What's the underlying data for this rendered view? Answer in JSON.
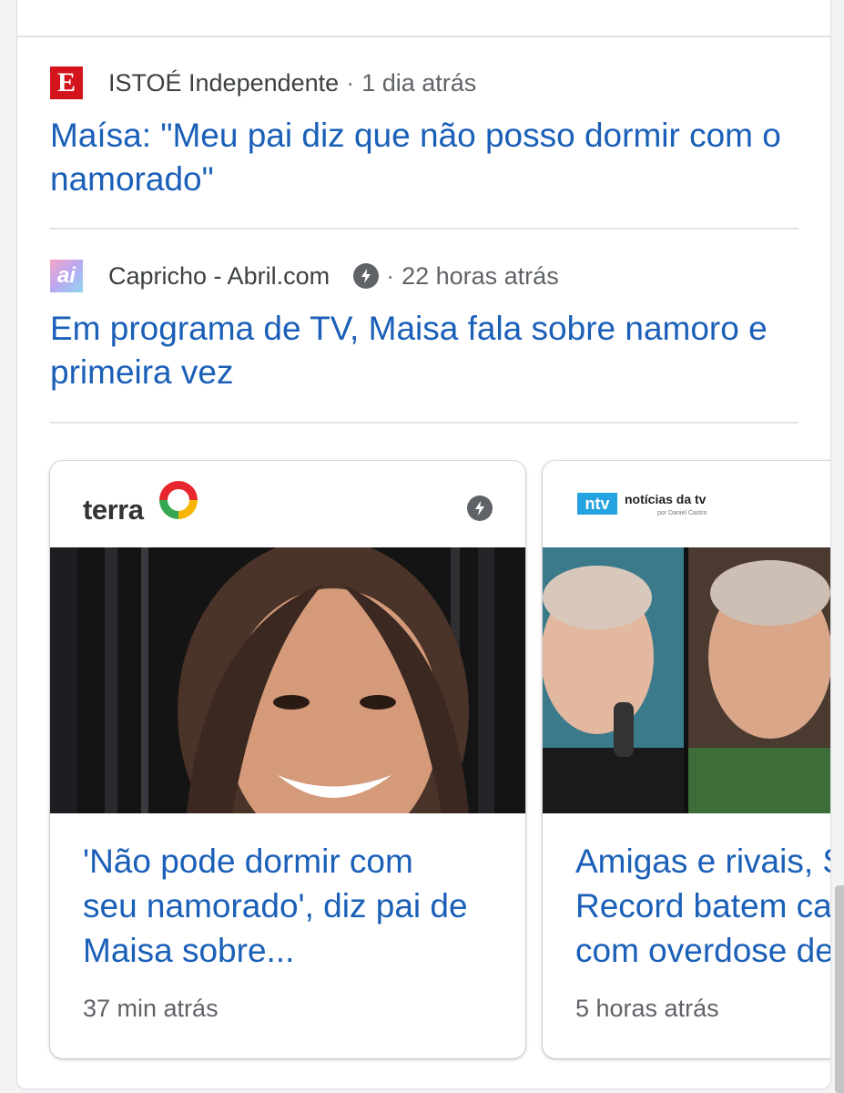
{
  "stories": [
    {
      "source": "ISTOÉ Independente",
      "time": "1 dia atrás",
      "headline": "Maísa: \"Meu pai diz que não posso dormir com o namorado\"",
      "logo_letter": "E",
      "logo_color": "#d3141c"
    },
    {
      "source": "Capricho - Abril.com",
      "time": "22 horas atrás",
      "headline": "Em programa de TV, Maisa fala sobre namoro e primeira vez",
      "logo_letter": "ai"
    }
  ],
  "separator": "·",
  "cards": [
    {
      "publisher": "terra",
      "title_lines": [
        "'Não pode dormir com",
        "seu namorado', diz pai de",
        "Maisa sobre..."
      ],
      "time": "37 min atrás"
    },
    {
      "publisher_badge": "ntv",
      "publisher": "notícias da tv",
      "publisher_sub": "por Daniel Castro",
      "title_lines": [
        "Amigas e rivais, S",
        "Record batem ca",
        "com overdose de"
      ],
      "time": "5 horas atrás"
    }
  ],
  "colors": {
    "headline": "#1a5fb8",
    "meta": "#5f6368",
    "amp_icon": "#5f6368"
  },
  "icons": [
    "amp-lightning-icon"
  ]
}
